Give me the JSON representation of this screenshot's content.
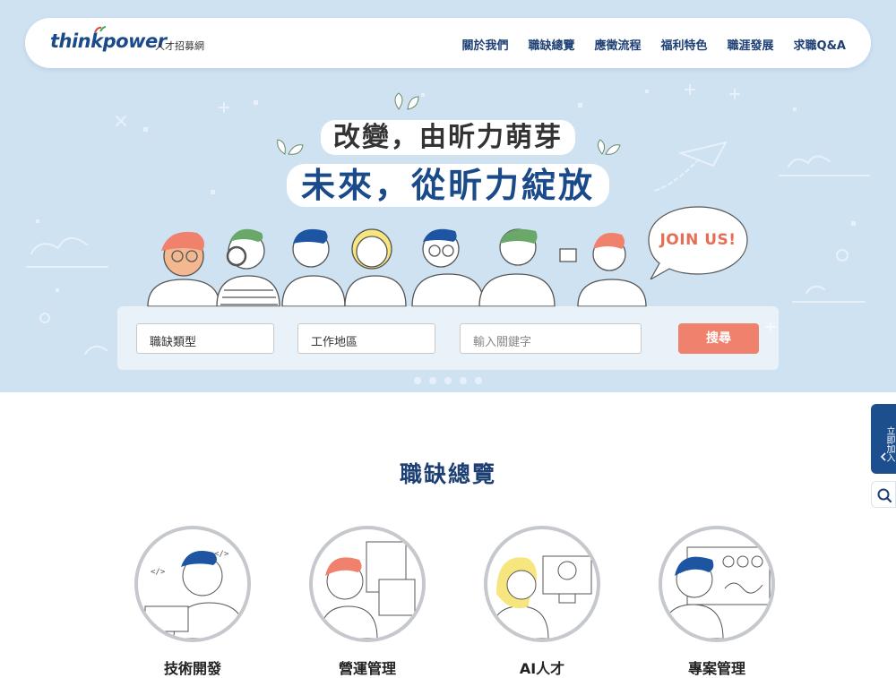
{
  "nav": {
    "logo_text": "thinkpower",
    "logo_sub": "人才招募網",
    "items": [
      "關於我們",
      "職缺總覽",
      "應徵流程",
      "福利特色",
      "職涯發展",
      "求職Q&A"
    ]
  },
  "hero": {
    "title_line1": "改變，由昕力萌芽",
    "title_line2": "未來，從昕力綻放",
    "join_text": "JOIN US!"
  },
  "search": {
    "job_type": "職缺類型",
    "location": "工作地區",
    "keyword_placeholder": "輸入關鍵字",
    "button": "搜尋"
  },
  "carousel": {
    "dot_count": 5
  },
  "side": {
    "join_label": "立即加入"
  },
  "section": {
    "title": "職缺總覽",
    "categories": [
      "技術開發",
      "營運管理",
      "AI人才",
      "專案管理"
    ]
  },
  "colors": {
    "hero_bg": "#cfe2f2",
    "navy": "#1d3f73",
    "accent": "#f0816d",
    "side_tab": "#1d4f8f"
  }
}
